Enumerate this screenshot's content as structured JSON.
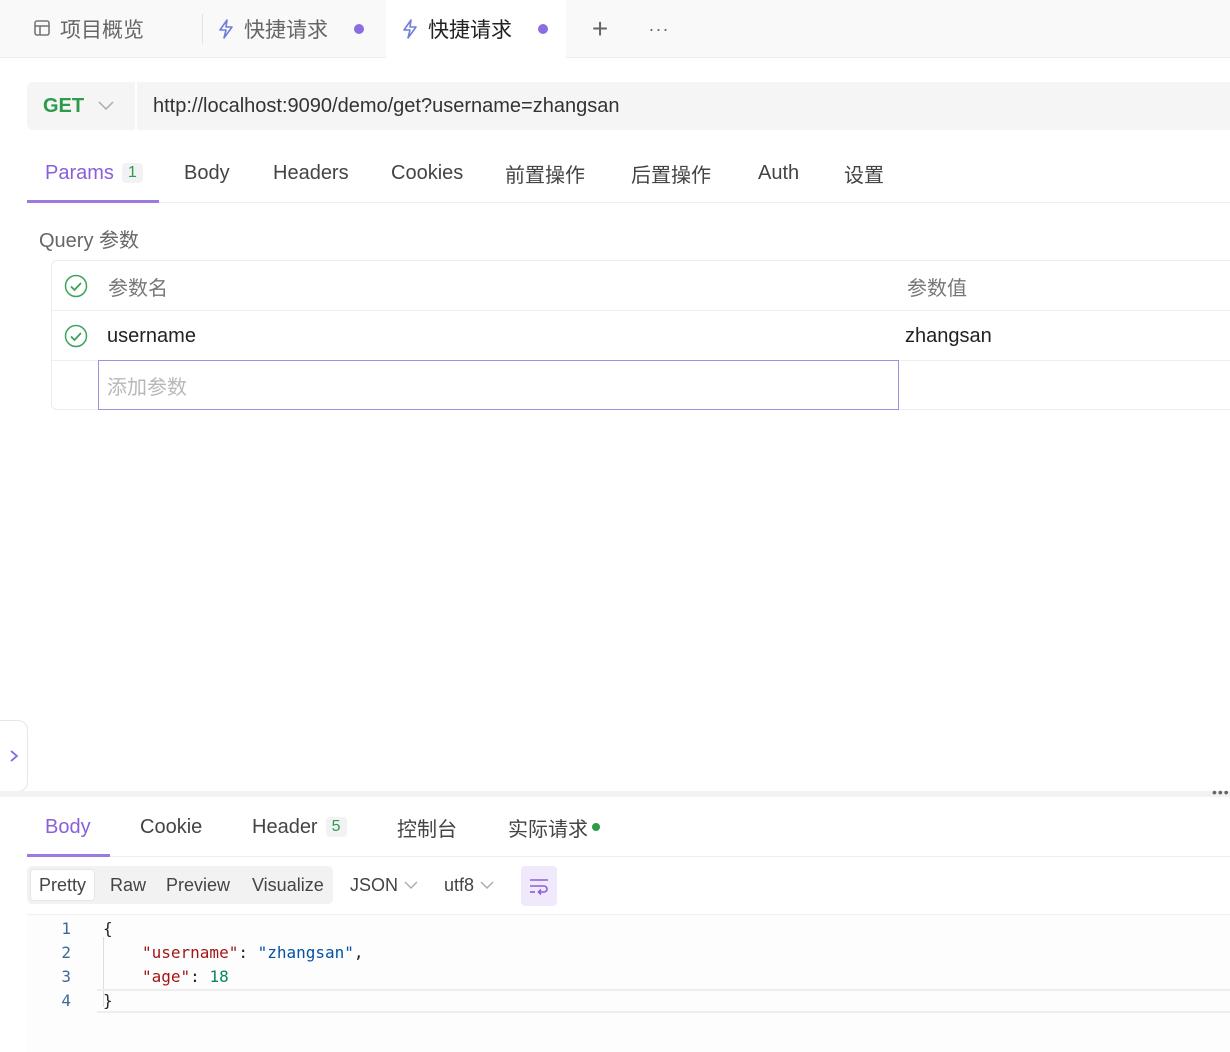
{
  "tabs": [
    {
      "label": "项目概览",
      "icon": "layout-icon"
    },
    {
      "label": "快捷请求",
      "icon": "bolt-icon",
      "unsaved": true
    },
    {
      "label": "快捷请求",
      "icon": "bolt-icon",
      "unsaved": true,
      "active": true
    }
  ],
  "tab_actions": {
    "add": "+",
    "more": "···"
  },
  "request": {
    "method": "GET",
    "url": "http://localhost:9090/demo/get?username=zhangsan"
  },
  "request_tabs": {
    "params": "Params",
    "params_count": "1",
    "body": "Body",
    "headers": "Headers",
    "cookies": "Cookies",
    "pre": "前置操作",
    "post": "后置操作",
    "auth": "Auth",
    "settings": "设置"
  },
  "query": {
    "section_label": "Query 参数",
    "col_name": "参数名",
    "col_value": "参数值",
    "rows": [
      {
        "name": "username",
        "value": "zhangsan",
        "enabled": true
      }
    ],
    "add_placeholder": "添加参数"
  },
  "response_tabs": {
    "body": "Body",
    "cookie": "Cookie",
    "header": "Header",
    "header_count": "5",
    "console": "控制台",
    "actual": "实际请求"
  },
  "response_toolbar": {
    "pretty": "Pretty",
    "raw": "Raw",
    "preview": "Preview",
    "visualize": "Visualize",
    "format": "JSON",
    "encoding": "utf8"
  },
  "response_body": {
    "line_numbers": [
      "1",
      "2",
      "3",
      "4"
    ],
    "open": "{",
    "close": "}",
    "key1": "\"username\"",
    "val1": "\"zhangsan\"",
    "key2": "\"age\"",
    "val2": "18"
  },
  "colors": {
    "accent": "#8a5fd9",
    "method_get": "#2e9b4b"
  }
}
